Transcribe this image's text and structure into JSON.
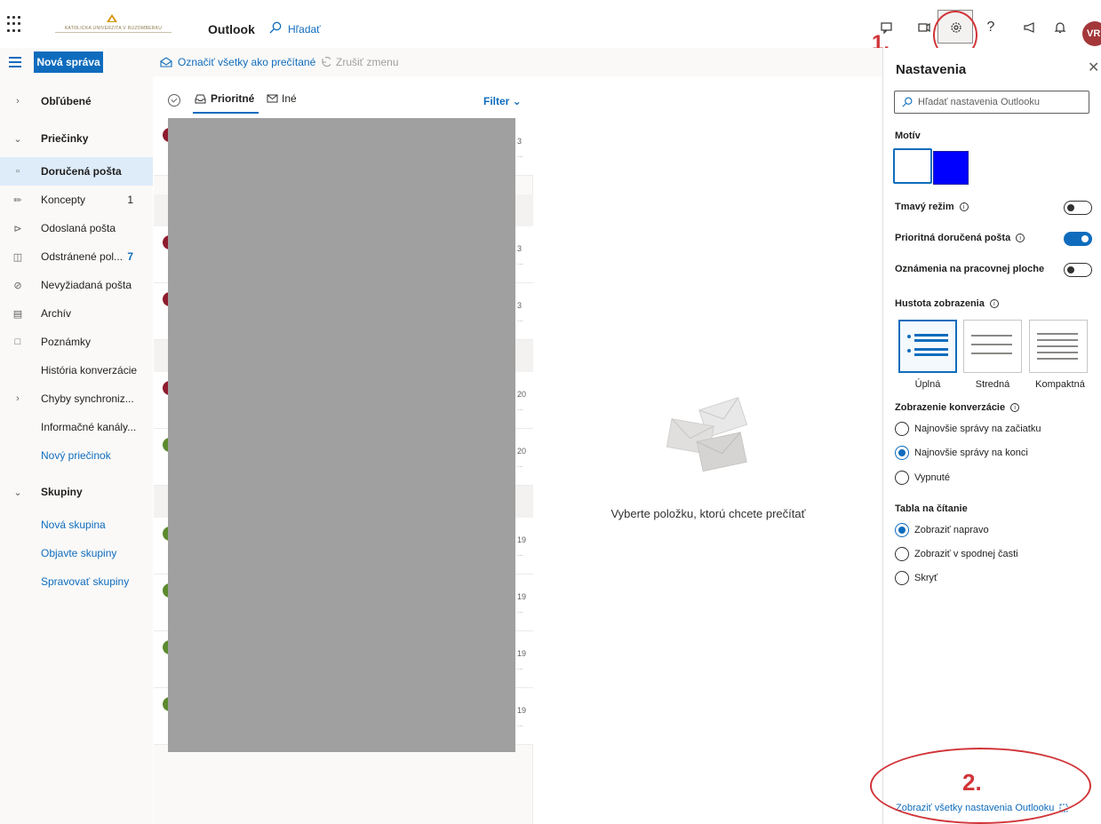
{
  "header": {
    "app_title": "Outlook",
    "search_label": "Hľadať",
    "logo_text": "KATOLÍCKA UNIVERZITA V RUŽOMBERKU",
    "avatar_initials": "VR"
  },
  "toolbar": {
    "new_mail_label": "Nová správa",
    "mark_all_read_label": "Označiť všetky ako prečítané",
    "undo_label": "Zrušiť zmenu"
  },
  "sidebar": {
    "favorites": "Obľúbené",
    "folders": "Priečinky",
    "items": [
      {
        "label": "Doručená pošta",
        "count": ""
      },
      {
        "label": "Koncepty",
        "count": "1"
      },
      {
        "label": "Odoslaná pošta",
        "count": ""
      },
      {
        "label": "Odstránené pol...",
        "count": "7"
      },
      {
        "label": "Nevyžiadaná pošta",
        "count": ""
      },
      {
        "label": "Archív",
        "count": ""
      },
      {
        "label": "Poznámky",
        "count": ""
      },
      {
        "label": "História konverzácie",
        "count": ""
      },
      {
        "label": "Chyby synchroniz...",
        "count": ""
      },
      {
        "label": "Informačné kanály...",
        "count": ""
      }
    ],
    "new_folder": "Nový priečinok",
    "groups": "Skupiny",
    "group_links": [
      "Nová skupina",
      "Objavte skupiny",
      "Spravovať skupiny"
    ]
  },
  "message_list": {
    "tab_focused": "Prioritné",
    "tab_other": "Iné",
    "filter_label": "Filter",
    "dates": [
      "3",
      "3",
      "3",
      "20",
      "20",
      "19",
      "19",
      "19",
      "19"
    ],
    "avatar_colors": [
      "#8e1b2e",
      "#8e1b2e",
      "#8e1b2e",
      "#8e1b2e",
      "#5c8a2e",
      "#5c8a2e",
      "#5c8a2e",
      "#5c8a2e",
      "#5c8a2e"
    ]
  },
  "reading_pane": {
    "empty_text": "Vyberte položku, ktorú chcete prečítať"
  },
  "settings": {
    "title": "Nastavenia",
    "search_placeholder": "Hľadať nastavenia Outlooku",
    "theme_heading": "Motív",
    "dark_mode": "Tmavý režim",
    "focused_inbox": "Prioritná doručená pošta",
    "desktop_notifications": "Oznámenia na pracovnej ploche",
    "display_density": "Hustota zobrazenia",
    "density_options": [
      "Úplná",
      "Stredná",
      "Kompaktná"
    ],
    "conversation_view": "Zobrazenie konverzácie",
    "conversation_options": [
      "Najnovšie správy na začiatku",
      "Najnovšie správy na konci",
      "Vypnuté"
    ],
    "reading_pane": "Tabla na čítanie",
    "reading_options": [
      "Zobraziť napravo",
      "Zobraziť v spodnej časti",
      "Skryť"
    ],
    "view_all": "Zobraziť všetky nastavenia Outlooku"
  },
  "annotations": {
    "step1": "1.",
    "step2": "2."
  },
  "colors": {
    "accent": "#0f6cbd",
    "annotation_red": "#d13438",
    "theme_blue": "#0000ff"
  }
}
